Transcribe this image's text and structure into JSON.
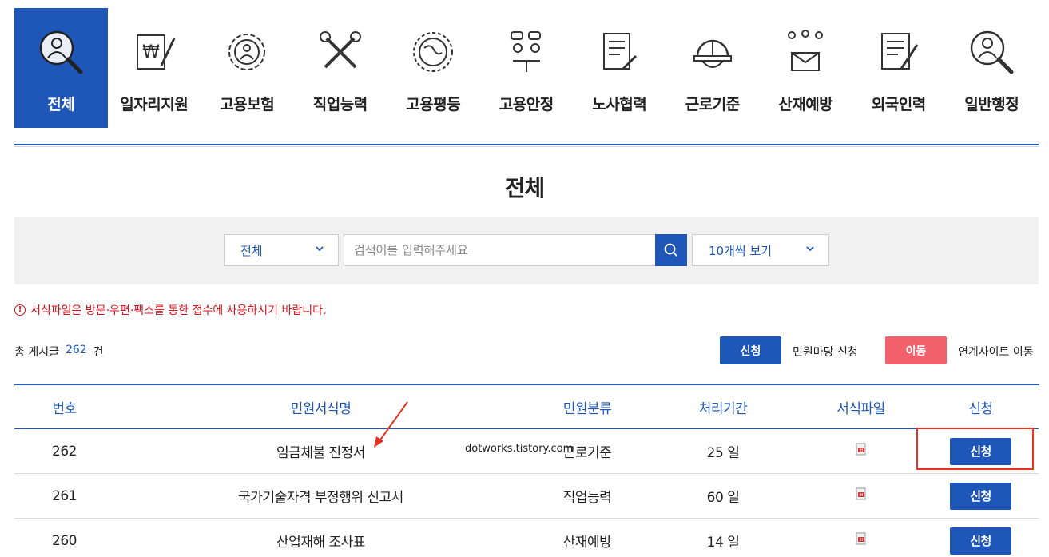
{
  "categories": [
    {
      "label": "전체",
      "icon": "person-magnifier-icon",
      "active": true
    },
    {
      "label": "일자리지원",
      "icon": "won-document-pen-icon",
      "active": false
    },
    {
      "label": "고용보험",
      "icon": "gear-person-icon",
      "active": false
    },
    {
      "label": "직업능력",
      "icon": "tools-icon",
      "active": false
    },
    {
      "label": "고용평등",
      "icon": "globe-icon",
      "active": false
    },
    {
      "label": "고용안정",
      "icon": "meeting-people-icon",
      "active": false
    },
    {
      "label": "노사협력",
      "icon": "contract-pen-icon",
      "active": false
    },
    {
      "label": "근로기준",
      "icon": "hard-hat-icon",
      "active": false
    },
    {
      "label": "산재예방",
      "icon": "people-mail-icon",
      "active": false
    },
    {
      "label": "외국인력",
      "icon": "form-pen-icon",
      "active": false
    },
    {
      "label": "일반행정",
      "icon": "person-magnifier-icon",
      "active": false
    }
  ],
  "page_title": "전체",
  "search": {
    "category_select": "전체",
    "placeholder": "검색어를 입력해주세요",
    "count_select": "10개씩 보기"
  },
  "notice": "서식파일은 방문·우편·팩스를 통한 접수에 사용하시기 바랍니다.",
  "total": {
    "prefix": "총 게시글",
    "count": "262",
    "suffix": "건"
  },
  "legend": {
    "apply_label": "신청",
    "apply_text": "민원마당 신청",
    "move_label": "이동",
    "move_text": "연계사이트 이동"
  },
  "table": {
    "headers": [
      "번호",
      "민원서식명",
      "민원분류",
      "처리기간",
      "서식파일",
      "신청"
    ],
    "rows": [
      {
        "no": "262",
        "name": "임금체불 진정서",
        "category": "근로기준",
        "period": "25 일",
        "action": "신청"
      },
      {
        "no": "261",
        "name": "국가기술자격 부정행위 신고서",
        "category": "직업능력",
        "period": "60 일",
        "action": "신청"
      },
      {
        "no": "260",
        "name": "산업재해 조사표",
        "category": "산재예방",
        "period": "14 일",
        "action": "신청"
      }
    ]
  },
  "watermark": "dotworks.tistory.com",
  "colors": {
    "primary": "#1e57b7",
    "alert": "#d6141c",
    "move": "#f0616b",
    "highlight": "#e53223"
  }
}
